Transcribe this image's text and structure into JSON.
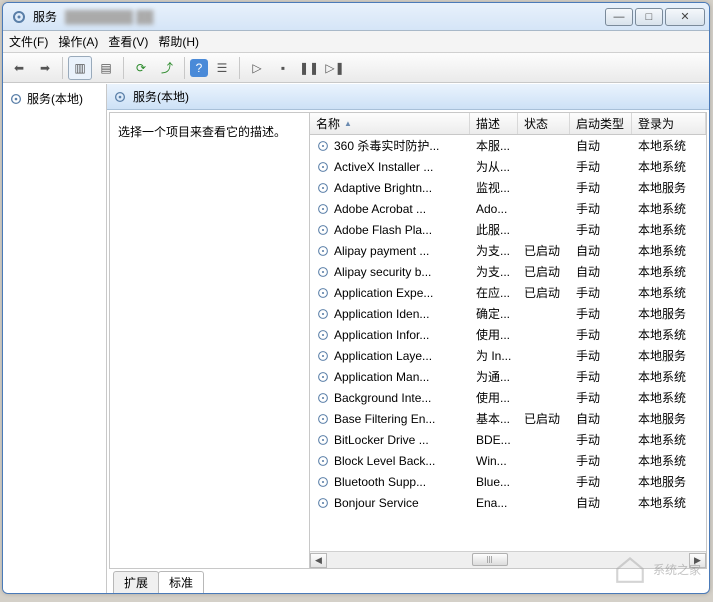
{
  "window": {
    "title": "服务",
    "subtitle_blur": "████████ ██"
  },
  "win_buttons": {
    "min": "—",
    "max": "□",
    "close": "✕"
  },
  "menu": {
    "file": "文件(F)",
    "action": "操作(A)",
    "view": "查看(V)",
    "help": "帮助(H)"
  },
  "left_tree": {
    "root": "服务(本地)"
  },
  "header_band": {
    "title": "服务(本地)"
  },
  "desc_pane": {
    "prompt": "选择一个项目来查看它的描述。"
  },
  "columns": {
    "name": "名称",
    "desc": "描述",
    "status": "状态",
    "startup": "启动类型",
    "logon": "登录为"
  },
  "rows": [
    {
      "name": "360 杀毒实时防护...",
      "desc": "本服...",
      "status": "",
      "startup": "自动",
      "logon": "本地系统"
    },
    {
      "name": "ActiveX Installer ...",
      "desc": "为从...",
      "status": "",
      "startup": "手动",
      "logon": "本地系统"
    },
    {
      "name": "Adaptive Brightn...",
      "desc": "监视...",
      "status": "",
      "startup": "手动",
      "logon": "本地服务"
    },
    {
      "name": "Adobe Acrobat ...",
      "desc": "Ado...",
      "status": "",
      "startup": "手动",
      "logon": "本地系统"
    },
    {
      "name": "Adobe Flash Pla...",
      "desc": "此服...",
      "status": "",
      "startup": "手动",
      "logon": "本地系统"
    },
    {
      "name": "Alipay payment ...",
      "desc": "为支...",
      "status": "已启动",
      "startup": "自动",
      "logon": "本地系统"
    },
    {
      "name": "Alipay security b...",
      "desc": "为支...",
      "status": "已启动",
      "startup": "自动",
      "logon": "本地系统"
    },
    {
      "name": "Application Expe...",
      "desc": "在应...",
      "status": "已启动",
      "startup": "手动",
      "logon": "本地系统"
    },
    {
      "name": "Application Iden...",
      "desc": "确定...",
      "status": "",
      "startup": "手动",
      "logon": "本地服务"
    },
    {
      "name": "Application Infor...",
      "desc": "使用...",
      "status": "",
      "startup": "手动",
      "logon": "本地系统"
    },
    {
      "name": "Application Laye...",
      "desc": "为 In...",
      "status": "",
      "startup": "手动",
      "logon": "本地服务"
    },
    {
      "name": "Application Man...",
      "desc": "为通...",
      "status": "",
      "startup": "手动",
      "logon": "本地系统"
    },
    {
      "name": "Background Inte...",
      "desc": "使用...",
      "status": "",
      "startup": "手动",
      "logon": "本地系统"
    },
    {
      "name": "Base Filtering En...",
      "desc": "基本...",
      "status": "已启动",
      "startup": "自动",
      "logon": "本地服务"
    },
    {
      "name": "BitLocker Drive ...",
      "desc": "BDE...",
      "status": "",
      "startup": "手动",
      "logon": "本地系统"
    },
    {
      "name": "Block Level Back...",
      "desc": "Win...",
      "status": "",
      "startup": "手动",
      "logon": "本地系统"
    },
    {
      "name": "Bluetooth Supp...",
      "desc": "Blue...",
      "status": "",
      "startup": "手动",
      "logon": "本地服务"
    },
    {
      "name": "Bonjour Service",
      "desc": "Ena...",
      "status": "",
      "startup": "自动",
      "logon": "本地系统"
    }
  ],
  "tabs": {
    "extended": "扩展",
    "standard": "标准"
  },
  "watermark": {
    "text": "系统之家"
  }
}
